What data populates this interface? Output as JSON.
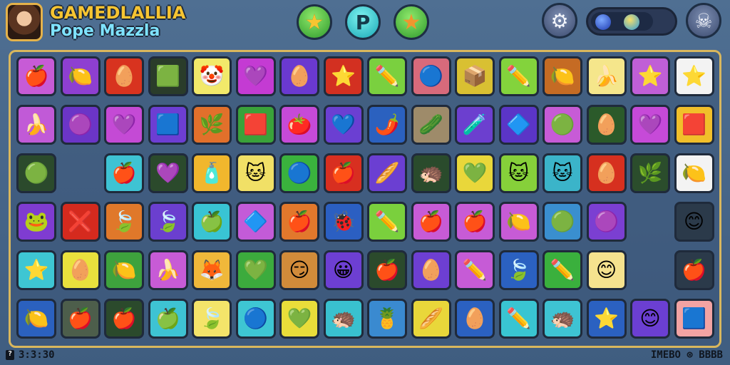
{
  "header": {
    "title_line1": "GAMEDLALLIA",
    "title_line2": "Popе Mazzla"
  },
  "controls": {
    "star_icon": "star-icon",
    "help_label": "P",
    "settings_icon": "gear-icon",
    "skull_icon": "skull-icon",
    "level_progress": 0.75
  },
  "footer": {
    "left_text": "3:3:30",
    "right_text": "IMEBO ⊗ BBBB"
  },
  "tiles": [
    {
      "bg": "#c75bd6",
      "icon": "🍎"
    },
    {
      "bg": "#8e3fd1",
      "icon": "🍋"
    },
    {
      "bg": "#d8331f",
      "icon": "🥚"
    },
    {
      "bg": "#2a3c2a",
      "icon": "🟩"
    },
    {
      "bg": "#f2e96a",
      "icon": "🤡"
    },
    {
      "bg": "#c43bd3",
      "icon": "💜"
    },
    {
      "bg": "#6a39d0",
      "icon": "🥚"
    },
    {
      "bg": "#d33021",
      "icon": "⭐"
    },
    {
      "bg": "#7ad03f",
      "icon": "✏️"
    },
    {
      "bg": "#d86a7b",
      "icon": "🔵"
    },
    {
      "bg": "#d9c032",
      "icon": "📦"
    },
    {
      "bg": "#83d33c",
      "icon": "✏️"
    },
    {
      "bg": "#c56b24",
      "icon": "🍋"
    },
    {
      "bg": "#f5e68b",
      "icon": "🍌"
    },
    {
      "bg": "#c05fd7",
      "icon": "⭐"
    },
    {
      "bg": "#f3f3f3",
      "icon": "⭐"
    },
    {
      "bg": "#c15ad7",
      "icon": "🍌"
    },
    {
      "bg": "#6b35c7",
      "icon": "🟣"
    },
    {
      "bg": "#c44ad5",
      "icon": "💜"
    },
    {
      "bg": "#6d3ed3",
      "icon": "🟦"
    },
    {
      "bg": "#e2702b",
      "icon": "🌿"
    },
    {
      "bg": "#3aa23a",
      "icon": "🟥"
    },
    {
      "bg": "#c64ad8",
      "icon": "🍅"
    },
    {
      "bg": "#6b3fd2",
      "icon": "💙"
    },
    {
      "bg": "#2b61bf",
      "icon": "🌶️"
    },
    {
      "bg": "#9e8b6a",
      "icon": "🥒"
    },
    {
      "bg": "#6c3fcf",
      "icon": "🧪"
    },
    {
      "bg": "#5b35c7",
      "icon": "🔷"
    },
    {
      "bg": "#c75bd6",
      "icon": "🟢"
    },
    {
      "bg": "#2b5a2a",
      "icon": "🥚"
    },
    {
      "bg": "#c64ad8",
      "icon": "💜"
    },
    {
      "bg": "#f1bf2a",
      "icon": "🟥"
    },
    {
      "bg": "#2b4a2c",
      "icon": "🟢"
    },
    {
      "bg": "",
      "icon": ""
    },
    {
      "bg": "#3ec3d3",
      "icon": "🍎"
    },
    {
      "bg": "#2b4a2c",
      "icon": "💜"
    },
    {
      "bg": "#f1b72d",
      "icon": "🧴"
    },
    {
      "bg": "#f1e066",
      "icon": "🐱"
    },
    {
      "bg": "#3ab23d",
      "icon": "🔵"
    },
    {
      "bg": "#d82f20",
      "icon": "🍎"
    },
    {
      "bg": "#6b3fd2",
      "icon": "🥖"
    },
    {
      "bg": "#2a4b2c",
      "icon": "🦔"
    },
    {
      "bg": "#e9d73a",
      "icon": "💚"
    },
    {
      "bg": "#86d03a",
      "icon": "🐱"
    },
    {
      "bg": "#3bb4c9",
      "icon": "🐱"
    },
    {
      "bg": "#d6301f",
      "icon": "🥚"
    },
    {
      "bg": "#2b4d2c",
      "icon": "🌿"
    },
    {
      "bg": "#f3f3f3",
      "icon": "🍋"
    },
    {
      "bg": "#7f3cd1",
      "icon": "🐸"
    },
    {
      "bg": "#d52a1e",
      "icon": "❌"
    },
    {
      "bg": "#e0782a",
      "icon": "🍃"
    },
    {
      "bg": "#6b3fcf",
      "icon": "🍃"
    },
    {
      "bg": "#39c4d4",
      "icon": "🍏"
    },
    {
      "bg": "#c35bd8",
      "icon": "🔷"
    },
    {
      "bg": "#e2782c",
      "icon": "🍎"
    },
    {
      "bg": "#2b5fc2",
      "icon": "🐞"
    },
    {
      "bg": "#7ad03d",
      "icon": "✏️"
    },
    {
      "bg": "#c75bd6",
      "icon": "🍎"
    },
    {
      "bg": "#c75bd6",
      "icon": "🍎"
    },
    {
      "bg": "#c75bd6",
      "icon": "🍋"
    },
    {
      "bg": "#3a8fcf",
      "icon": "🟢"
    },
    {
      "bg": "#7b3fd2",
      "icon": "🟣"
    },
    {
      "bg": "",
      "icon": ""
    },
    {
      "bg": "#2b3a4a",
      "icon": "😊"
    },
    {
      "bg": "#3ec6d3",
      "icon": "⭐"
    },
    {
      "bg": "#e9e13d",
      "icon": "🥚"
    },
    {
      "bg": "#3ea23d",
      "icon": "🍋"
    },
    {
      "bg": "#c75bd6",
      "icon": "🍌"
    },
    {
      "bg": "#f0b83a",
      "icon": "🦊"
    },
    {
      "bg": "#3cab3d",
      "icon": "💚"
    },
    {
      "bg": "#d18b3a",
      "icon": "😏"
    },
    {
      "bg": "#6d3fd2",
      "icon": "😀"
    },
    {
      "bg": "#2b4a2c",
      "icon": "🍎"
    },
    {
      "bg": "#6d3fd2",
      "icon": "🥚"
    },
    {
      "bg": "#c65bd6",
      "icon": "✏️"
    },
    {
      "bg": "#2b61c1",
      "icon": "🍃"
    },
    {
      "bg": "#3ab03d",
      "icon": "✏️"
    },
    {
      "bg": "#f5e28e",
      "icon": "😊"
    },
    {
      "bg": "",
      "icon": ""
    },
    {
      "bg": "#2b3a4a",
      "icon": "🍎"
    },
    {
      "bg": "#2b61bf",
      "icon": "🍋"
    },
    {
      "bg": "#4d5e4b",
      "icon": "🍎"
    },
    {
      "bg": "#2b4a2c",
      "icon": "🍎"
    },
    {
      "bg": "#3ec3d3",
      "icon": "🍏"
    },
    {
      "bg": "#f4e46a",
      "icon": "🍃"
    },
    {
      "bg": "#3ec6d3",
      "icon": "🔵"
    },
    {
      "bg": "#e9dd3a",
      "icon": "💚"
    },
    {
      "bg": "#39c1cf",
      "icon": "🦔"
    },
    {
      "bg": "#3a8ad0",
      "icon": "🍍"
    },
    {
      "bg": "#e9d73a",
      "icon": "🥖"
    },
    {
      "bg": "#2b61c1",
      "icon": "🥚"
    },
    {
      "bg": "#39c5d2",
      "icon": "✏️"
    },
    {
      "bg": "#3ec3d3",
      "icon": "🦔"
    },
    {
      "bg": "#2b61c1",
      "icon": "⭐"
    },
    {
      "bg": "#6b3fd2",
      "icon": "😊"
    },
    {
      "bg": "#f2a3a3",
      "icon": "🟦"
    }
  ]
}
